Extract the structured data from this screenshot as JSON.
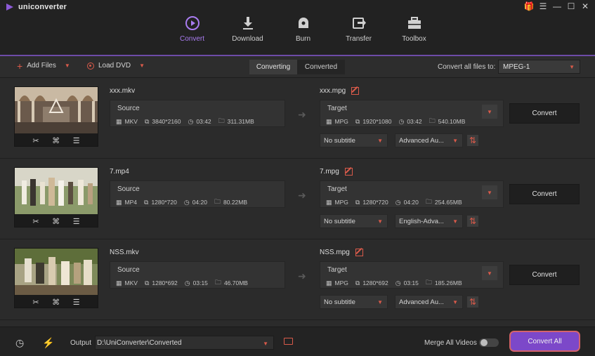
{
  "app": {
    "name": "uniconverter"
  },
  "nav": [
    {
      "label": "Convert",
      "icon": "play-circle-icon",
      "active": true
    },
    {
      "label": "Download",
      "icon": "download-icon",
      "active": false
    },
    {
      "label": "Burn",
      "icon": "burn-disc-icon",
      "active": false
    },
    {
      "label": "Transfer",
      "icon": "transfer-icon",
      "active": false
    },
    {
      "label": "Toolbox",
      "icon": "toolbox-icon",
      "active": false
    }
  ],
  "toolbar": {
    "add_files": "Add Files",
    "load_dvd": "Load DVD",
    "tabs": [
      "Converting",
      "Converted"
    ],
    "convert_all_to_label": "Convert all files to:",
    "convert_all_to_value": "MPEG-1"
  },
  "files": [
    {
      "name": "xxx.mkv",
      "source": {
        "title": "Source",
        "format": "MKV",
        "resolution": "3840*2160",
        "duration": "03:42",
        "size": "311.31MB"
      },
      "target_name": "xxx.mpg",
      "target": {
        "title": "Target",
        "format": "MPG",
        "resolution": "1920*1080",
        "duration": "03:42",
        "size": "540.10MB"
      },
      "subtitle": "No subtitle",
      "audio": "Advanced Au...",
      "convert": "Convert"
    },
    {
      "name": "7.mp4",
      "source": {
        "title": "Source",
        "format": "MP4",
        "resolution": "1280*720",
        "duration": "04:20",
        "size": "80.22MB"
      },
      "target_name": "7.mpg",
      "target": {
        "title": "Target",
        "format": "MPG",
        "resolution": "1280*720",
        "duration": "04:20",
        "size": "254.65MB"
      },
      "subtitle": "No subtitle",
      "audio": "English-Adva...",
      "convert": "Convert"
    },
    {
      "name": "NSS.mkv",
      "source": {
        "title": "Source",
        "format": "MKV",
        "resolution": "1280*692",
        "duration": "03:15",
        "size": "46.70MB"
      },
      "target_name": "NSS.mpg",
      "target": {
        "title": "Target",
        "format": "MPG",
        "resolution": "1280*692",
        "duration": "03:15",
        "size": "185.26MB"
      },
      "subtitle": "No subtitle",
      "audio": "Advanced Au...",
      "convert": "Convert"
    }
  ],
  "bottom": {
    "output_label": "Output",
    "output_path": "D:\\UniConverter\\Converted",
    "merge_label": "Merge All Videos",
    "merge_on": false,
    "convert_all": "Convert All"
  },
  "colors": {
    "accent": "#7c48c9",
    "icon_red": "#d95a4a",
    "background": "#2b2b2b"
  }
}
